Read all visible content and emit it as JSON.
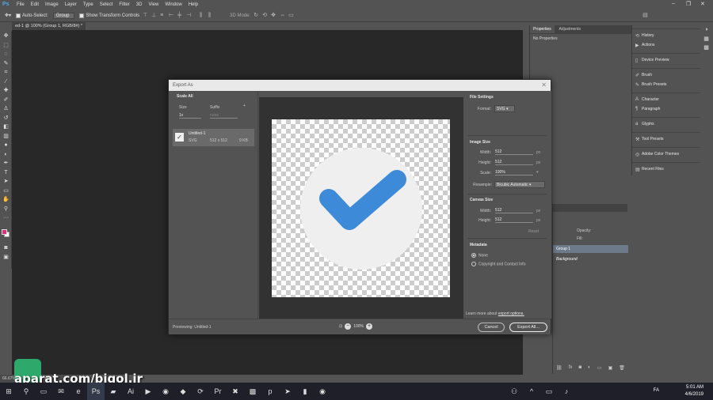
{
  "menu": [
    "File",
    "Edit",
    "Image",
    "Layer",
    "Type",
    "Select",
    "Filter",
    "3D",
    "View",
    "Window",
    "Help"
  ],
  "optbar": {
    "auto_select": "Auto-Select:",
    "group": "Group",
    "show_transform": "Show Transform Controls",
    "mode_3d": "3D Mode:"
  },
  "doc_tab": "ed-1 @ 100% (Group 1, RGB/8#) *",
  "props": {
    "tab1": "Properties",
    "tab2": "Adjustments",
    "empty": "No Properties"
  },
  "panels": [
    "History",
    "Actions",
    "Device Preview",
    "Brush",
    "Brush Presets",
    "Character",
    "Paragraph",
    "Glyphs",
    "Tool Presets",
    "Adobe Color Themes",
    "Recent Files"
  ],
  "layers": {
    "opacity": "Opacity:",
    "fill": "Fill:",
    "group": "Group 1",
    "bg": "Background"
  },
  "dialog": {
    "title": "Export As",
    "scale_all": "Scale All",
    "size_label": "Size",
    "suffix_label": "Suffix",
    "size_value": "1x",
    "suffix_placeholder": "none",
    "asset_name": "Untitled-1",
    "asset_format": "SVG",
    "asset_dims": "512 x 512",
    "asset_size": "9 KB",
    "file_settings": "File Settings",
    "format_label": "Format:",
    "format_value": "SVG",
    "image_size": "Image Size",
    "width_label": "Width:",
    "height_label": "Height:",
    "scale_label": "Scale:",
    "resample_label": "Resample:",
    "img_width": "512",
    "img_height": "512",
    "img_scale": "100%",
    "resample_value": "Bicubic Automatic",
    "unit": "px",
    "canvas_size": "Canvas Size",
    "cv_width": "512",
    "cv_height": "512",
    "reset": "Reset",
    "metadata": "Metadata",
    "meta_none": "None",
    "meta_copyright": "Copyright and Contact Info",
    "learn_more": "Learn more about",
    "learn_link": "export options.",
    "previewing": "Previewing: Untitled-1",
    "zoom": "100%",
    "cancel": "Cancel",
    "export_all": "Export All..."
  },
  "check_color": "#3d8bd8",
  "status": "66.67%   Doc: 768K/0 bytes",
  "watermark": "aparat.com/bigol.ir",
  "tray": {
    "lang": "FA",
    "time": "5:01 AM",
    "date": "4/6/2019"
  }
}
